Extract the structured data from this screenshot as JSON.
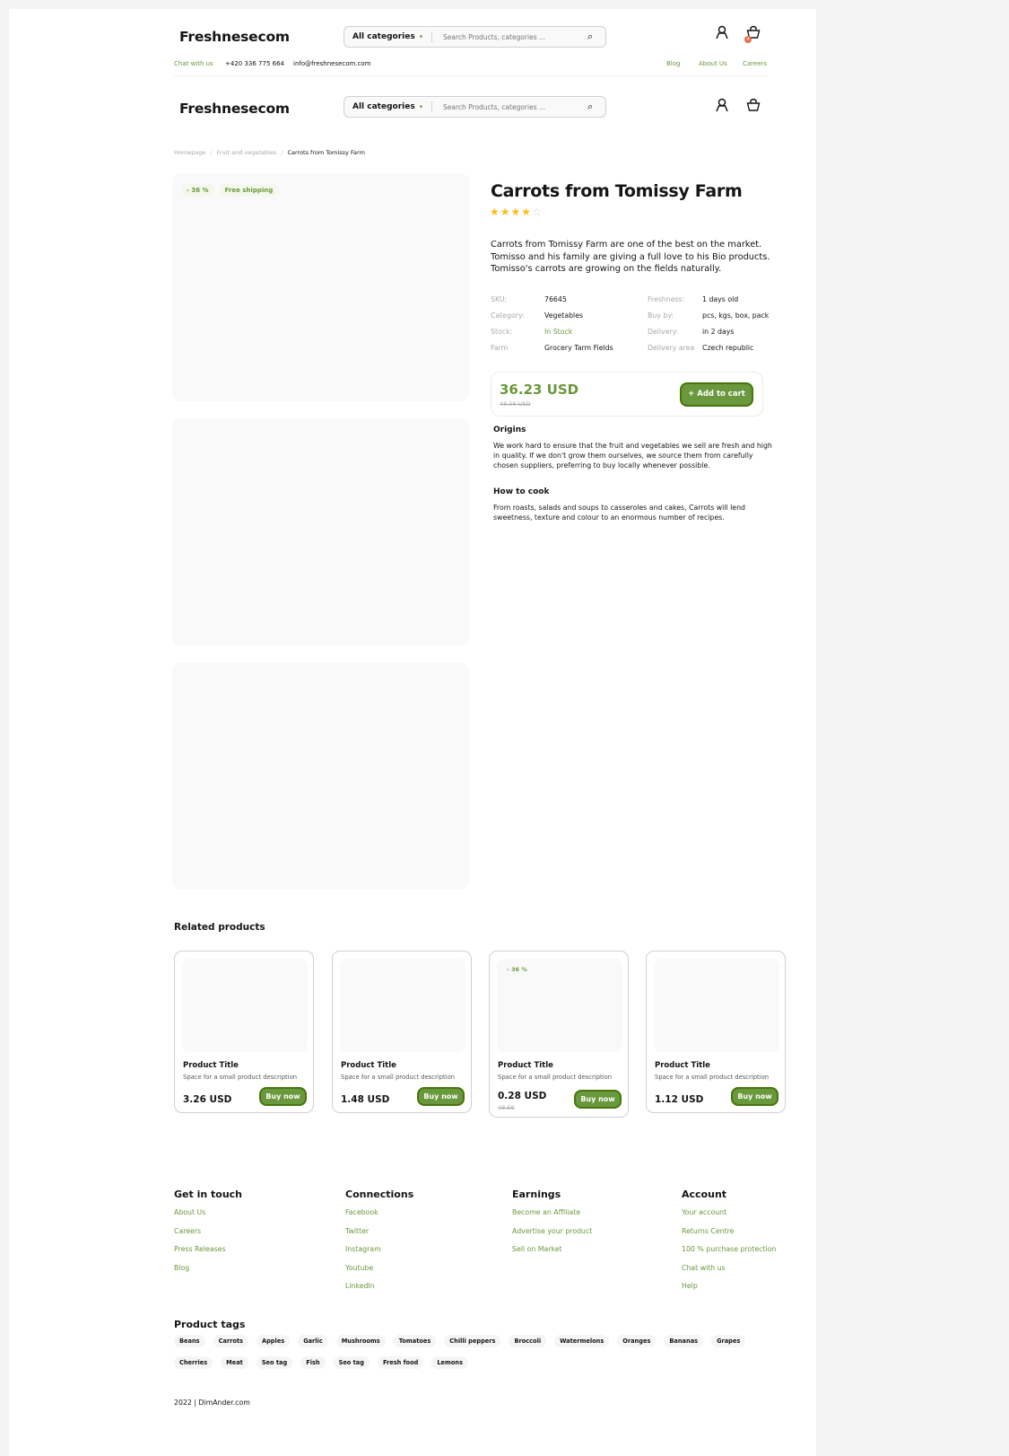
{
  "header1": {
    "logo": "Freshnesecom",
    "category_label": "All categories",
    "search_placeholder": "Search Products, categories ...",
    "cart_badge": "4",
    "chat": "Chat with us",
    "phone": "+420 336 775 664",
    "email": "info@freshnesecom.com",
    "nav": [
      "Blog",
      "About Us",
      "Careers"
    ]
  },
  "header2": {
    "logo": "Freshnesecom",
    "category_label": "All categories",
    "search_placeholder": "Search Products, categories ..."
  },
  "breadcrumb": [
    "Homepage",
    "Fruit and vegetables",
    "Carrots from Tomissy Farm"
  ],
  "badges": [
    "- 36 %",
    "Free shipping"
  ],
  "product": {
    "title": "Carrots from Tomissy Farm",
    "rating": 4,
    "rating_max": 5,
    "description": "Carrots from Tomissy Farm are one of the best on the market. Tomisso and his family are giving a full love to his Bio products. Tomisso's carrots are growing on the fields naturally.",
    "specs_left": [
      {
        "label": "SKU:",
        "value": "76645"
      },
      {
        "label": "Category:",
        "value": "Vegetables"
      },
      {
        "label": "Stock:",
        "value": "In Stock"
      },
      {
        "label": "Farm",
        "value": "Grocery Tarm Fields"
      }
    ],
    "specs_right": [
      {
        "label": "Freshness:",
        "value": "1 days old"
      },
      {
        "label": "Buy by:",
        "value": "pcs, kgs, box, pack"
      },
      {
        "label": "Delivery:",
        "value": "in 2 days"
      },
      {
        "label": "Delivery area",
        "value": "Czech republic"
      }
    ],
    "price": "36.23 USD",
    "old_price": "48.56 USD",
    "add_to_cart": "Add to cart",
    "origins_title": "Origins",
    "origins_text": "We work hard to ensure that the fruit and vegetables we sell are fresh and high in quality. If we don't grow them ourselves, we source them from carefully chosen suppliers, preferring to buy locally whenever possible.",
    "cook_title": "How to cook",
    "cook_text": "From roasts, salads and soups to casseroles and cakes, Carrots will lend sweetness, texture and colour to an enormous number of recipes."
  },
  "related": {
    "title": "Related products",
    "items": [
      {
        "title": "Product Title",
        "desc": "Space for a small product description",
        "price": "3.26 USD",
        "old": "",
        "badge": "",
        "button": "Buy now"
      },
      {
        "title": "Product Title",
        "desc": "Space for a small product description",
        "price": "1.48 USD",
        "old": "",
        "badge": "",
        "button": "Buy now"
      },
      {
        "title": "Product Title",
        "desc": "Space for a small product description",
        "price": "0.28 USD",
        "old": "48.56",
        "badge": "- 36 %",
        "button": "Buy now"
      },
      {
        "title": "Product Title",
        "desc": "Space for a small product description",
        "price": "1.12 USD",
        "old": "",
        "badge": "",
        "button": "Buy now"
      }
    ]
  },
  "footer": {
    "columns": [
      {
        "title": "Get in touch",
        "links": [
          "About Us",
          "Careers",
          "Press Releases",
          "Blog"
        ]
      },
      {
        "title": "Connections",
        "links": [
          "Facebook",
          "Twitter",
          "Instagram",
          "Youtube",
          "LinkedIn"
        ]
      },
      {
        "title": "Earnings",
        "links": [
          "Become an Affiliate",
          "Advertise your product",
          "Sell on Market"
        ]
      },
      {
        "title": "Account",
        "links": [
          "Your account",
          "Returns Centre",
          "100 % purchase protection",
          "Chat with us",
          "Help"
        ]
      }
    ],
    "tags_title": "Product tags",
    "tags_row1": [
      "Beans",
      "Carrots",
      "Apples",
      "Garlic",
      "Mushrooms",
      "Tomatoes",
      "Chilli peppers",
      "Broccoli",
      "Watermelons",
      "Oranges",
      "Bananas",
      "Grapes"
    ],
    "tags_row2": [
      "Cherries",
      "Meat",
      "Seo tag",
      "Fish",
      "Seo tag",
      "Fresh food",
      "Lemons"
    ],
    "copyright": "2022 | DimAnder.com"
  },
  "colors": {
    "accent": "#6a983c",
    "star": "#fdbc15",
    "badge_dot": "#e5704b"
  }
}
